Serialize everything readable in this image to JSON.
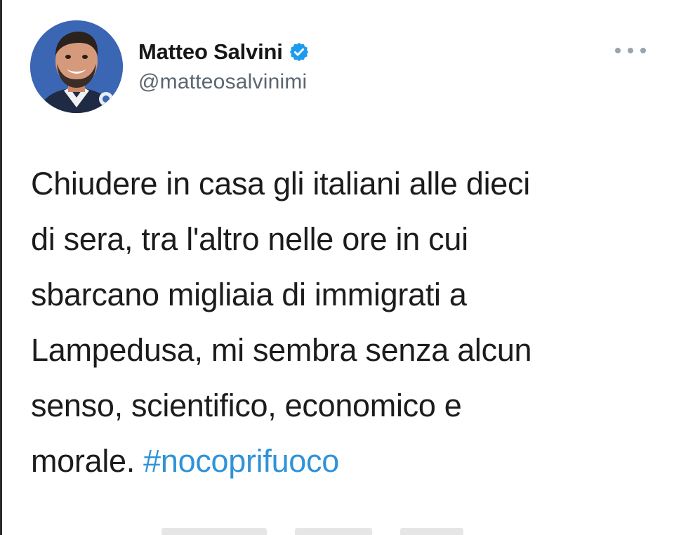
{
  "tweet": {
    "author": {
      "display_name": "Matteo Salvini",
      "handle": "@matteosalvinimi",
      "verified": true,
      "avatar_icon": "profile-photo"
    },
    "text_lines": [
      "Chiudere in casa gli italiani alle dieci",
      "di sera, tra l'altro nelle ore in cui",
      "sbarcano migliaia di immigrati a",
      "Lampedusa, mi sembra senza alcun",
      "senso, scientifico, economico e",
      "morale."
    ],
    "hashtag": "#nocoprifuoco",
    "more_icon": "ellipsis-icon"
  },
  "colors": {
    "hashtag": "#2f93d8",
    "verified_badge": "#1d9bf0",
    "handle": "#5b6670",
    "text": "#1c1c1c"
  }
}
